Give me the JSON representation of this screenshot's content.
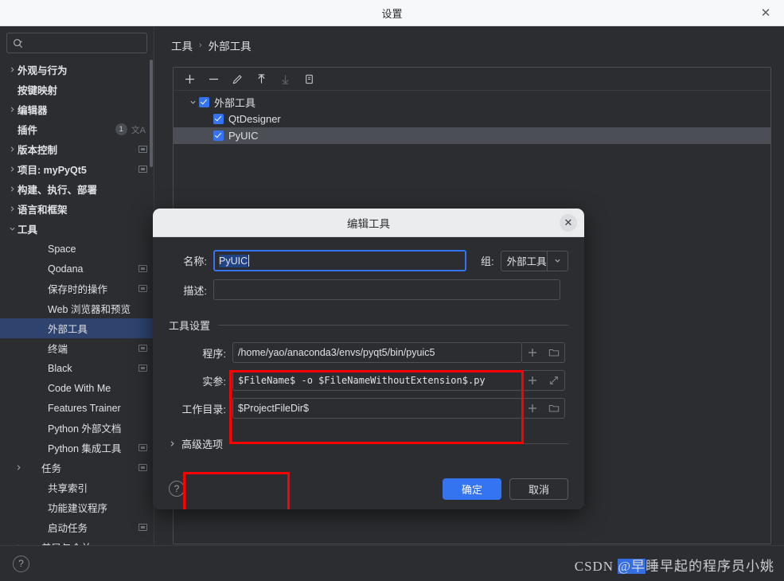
{
  "window": {
    "title": "设置",
    "close_icon": "close-icon"
  },
  "sidebar": {
    "search": {
      "placeholder": "",
      "icon": "search-icon"
    },
    "items": [
      {
        "label": "外观与行为",
        "level": 1,
        "arrow": "collapsed",
        "badge": null,
        "screen_icon": false
      },
      {
        "label": "按键映射",
        "level": 1,
        "arrow": "none",
        "badge": null,
        "screen_icon": false
      },
      {
        "label": "编辑器",
        "level": 1,
        "arrow": "collapsed",
        "badge": null,
        "screen_icon": false
      },
      {
        "label": "插件",
        "level": 1,
        "arrow": "none",
        "badge": "1",
        "lang_icon": true,
        "screen_icon": false
      },
      {
        "label": "版本控制",
        "level": 1,
        "arrow": "collapsed",
        "badge": null,
        "screen_icon": true
      },
      {
        "label": "项目: myPyQt5",
        "level": 1,
        "arrow": "collapsed",
        "badge": null,
        "screen_icon": true
      },
      {
        "label": "构建、执行、部署",
        "level": 1,
        "arrow": "collapsed",
        "badge": null,
        "screen_icon": false
      },
      {
        "label": "语言和框架",
        "level": 1,
        "arrow": "collapsed",
        "badge": null,
        "screen_icon": false
      },
      {
        "label": "工具",
        "level": 1,
        "arrow": "expanded",
        "badge": null,
        "screen_icon": false
      },
      {
        "label": "Space",
        "level": 2,
        "arrow": "none",
        "badge": null,
        "screen_icon": false
      },
      {
        "label": "Qodana",
        "level": 2,
        "arrow": "none",
        "badge": null,
        "screen_icon": true
      },
      {
        "label": "保存时的操作",
        "level": 2,
        "arrow": "none",
        "badge": null,
        "screen_icon": true
      },
      {
        "label": "Web 浏览器和预览",
        "level": 2,
        "arrow": "none",
        "badge": null,
        "screen_icon": false
      },
      {
        "label": "外部工具",
        "level": 2,
        "arrow": "none",
        "badge": null,
        "screen_icon": false,
        "selected": true
      },
      {
        "label": "终端",
        "level": 2,
        "arrow": "none",
        "badge": null,
        "screen_icon": true
      },
      {
        "label": "Black",
        "level": 2,
        "arrow": "none",
        "badge": null,
        "screen_icon": true
      },
      {
        "label": "Code With Me",
        "level": 2,
        "arrow": "none",
        "badge": null,
        "screen_icon": false
      },
      {
        "label": "Features Trainer",
        "level": 2,
        "arrow": "none",
        "badge": null,
        "screen_icon": false
      },
      {
        "label": "Python 外部文档",
        "level": 2,
        "arrow": "none",
        "badge": null,
        "screen_icon": false
      },
      {
        "label": "Python 集成工具",
        "level": 2,
        "arrow": "none",
        "badge": null,
        "screen_icon": true
      },
      {
        "label": "任务",
        "level": 2,
        "arrow": "collapsed",
        "badge": null,
        "screen_icon": true
      },
      {
        "label": "共享索引",
        "level": 2,
        "arrow": "none",
        "badge": null,
        "screen_icon": false
      },
      {
        "label": "功能建议程序",
        "level": 2,
        "arrow": "none",
        "badge": null,
        "screen_icon": false
      },
      {
        "label": "启动任务",
        "level": 2,
        "arrow": "none",
        "badge": null,
        "screen_icon": true
      },
      {
        "label": "差异与合并",
        "level": 2,
        "arrow": "collapsed",
        "badge": null,
        "screen_icon": false
      }
    ]
  },
  "main": {
    "breadcrumb": {
      "parent": "工具",
      "separator": "›",
      "current": "外部工具"
    },
    "nav": {
      "back_icon": "arrow-left-icon",
      "forward_icon": "arrow-right-icon"
    },
    "toolbar": [
      {
        "name": "add-tool-button",
        "glyph": "+",
        "enabled": true
      },
      {
        "name": "remove-tool-button",
        "glyph": "−",
        "enabled": true
      },
      {
        "name": "edit-tool-button",
        "glyph": "pencil",
        "enabled": true
      },
      {
        "name": "move-up-button",
        "glyph": "arrow-up",
        "enabled": true
      },
      {
        "name": "move-down-button",
        "glyph": "arrow-down",
        "enabled": false
      },
      {
        "name": "copy-tool-button",
        "glyph": "copy",
        "enabled": true
      }
    ],
    "tree": [
      {
        "label": "外部工具",
        "level": 0,
        "checked": true,
        "expanded": true,
        "selected": false
      },
      {
        "label": "QtDesigner",
        "level": 1,
        "checked": true,
        "expanded": null,
        "selected": false
      },
      {
        "label": "PyUIC",
        "level": 1,
        "checked": true,
        "expanded": null,
        "selected": true
      }
    ]
  },
  "dialog": {
    "title": "编辑工具",
    "close_icon": "close-icon",
    "name_label": "名称:",
    "name_value": "PyUIC",
    "group_label": "组:",
    "group_value": "外部工具",
    "desc_label": "描述:",
    "desc_value": "",
    "section_title": "工具设置",
    "fields": [
      {
        "label": "程序:",
        "value": "/home/yao/anaconda3/envs/pyqt5/bin/pyuic5",
        "mono": false,
        "browse_icon": "folder-icon"
      },
      {
        "label": "实参:",
        "value": "$FileName$ -o $FileNameWithoutExtension$.py",
        "mono": true,
        "browse_icon": "expand-icon"
      },
      {
        "label": "工作目录:",
        "value": "$ProjectFileDir$",
        "mono": false,
        "browse_icon": "folder-icon"
      }
    ],
    "insert_macro_glyph": "+",
    "advanced_label": "高级选项",
    "help_glyph": "?",
    "ok_label": "确定",
    "cancel_label": "取消"
  },
  "bottom": {
    "help_glyph": "?"
  },
  "watermark": {
    "prefix": "CSDN ",
    "highlight": "@早",
    "rest": "睡早起的程序员小姚"
  },
  "colors": {
    "accent_blue": "#3574f0",
    "selection_blue": "#2e436e",
    "highlight_red": "#ff0000",
    "panel_bg": "#2b2d30",
    "titlebar_bg": "#f7f8fa",
    "dialog_header_bg": "#ebecee"
  }
}
